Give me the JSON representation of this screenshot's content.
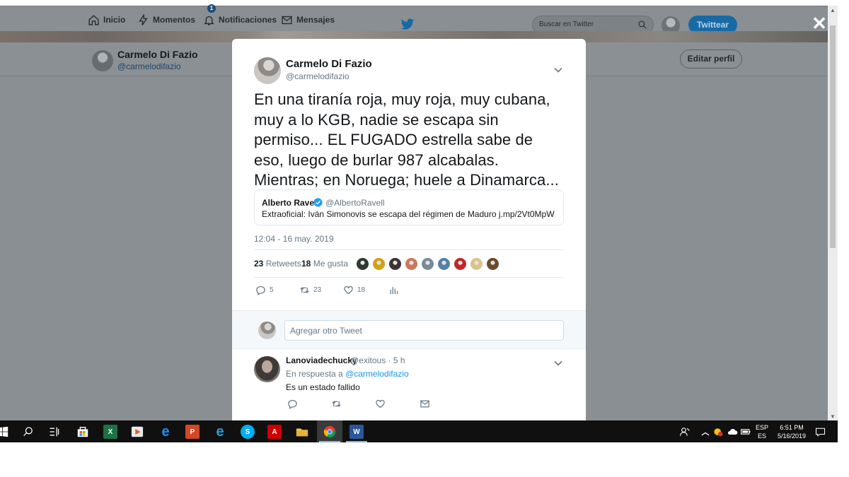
{
  "nav": {
    "home_label": "Inicio",
    "moments_label": "Momentos",
    "notifications_label": "Notificaciones",
    "notifications_count": "1",
    "messages_label": "Mensajes",
    "search_placeholder": "Buscar en Twitter",
    "tweet_button_label": "Twittear",
    "close_glyph": "✕"
  },
  "profile": {
    "name": "Carmelo Di Fazio",
    "handle": "@carmelodifazio",
    "edit_label": "Editar perfil"
  },
  "tweet": {
    "author_name": "Carmelo Di Fazio",
    "author_handle": "@carmelodifazio",
    "text": "En una tiranía roja, muy roja, muy cubana, muy a lo KGB, nadie se escapa sin permiso... EL FUGADO estrella sabe de eso, luego de burlar 987 alcabalas. Mientras; en Noruega; huele a Dinamarca...",
    "quote": {
      "name": "Alberto Ravell",
      "handle": "@AlbertoRavell",
      "text": "Extraoficial: Iván Simonovis se escapa del régimen de Maduro j.mp/2Vt0MpW"
    },
    "timestamp": "12:04 - 16 may. 2019",
    "retweets_count": "23",
    "retweets_label": "Retweets",
    "likes_count": "18",
    "likes_label": "Me gusta",
    "liker_colors": [
      "#2d3a33",
      "#d4a017",
      "#3a3534",
      "#c9785c",
      "#7a8a99",
      "#5a7fa8",
      "#c0272d",
      "#d8c48a",
      "#6b4a2e"
    ],
    "actions": {
      "reply_count": "5",
      "retweet_count": "23",
      "like_count": "18"
    }
  },
  "reply_box": {
    "placeholder": "Agregar otro Tweet"
  },
  "reply": {
    "name": "Lanoviadechucky",
    "handle_time": "@exitous · 5 h",
    "context_prefix": "En respuesta a",
    "context_handle": "@carmelodifazio",
    "text": "Es un estado fallido"
  },
  "taskbar": {
    "lang_top": "ESP",
    "lang_bottom": "ES",
    "time": "6:51 PM",
    "date": "5/16/2019"
  },
  "colors": {
    "twitter_blue": "#1da1f2",
    "muted_text": "#657786",
    "overlay": "#8a8f93"
  }
}
